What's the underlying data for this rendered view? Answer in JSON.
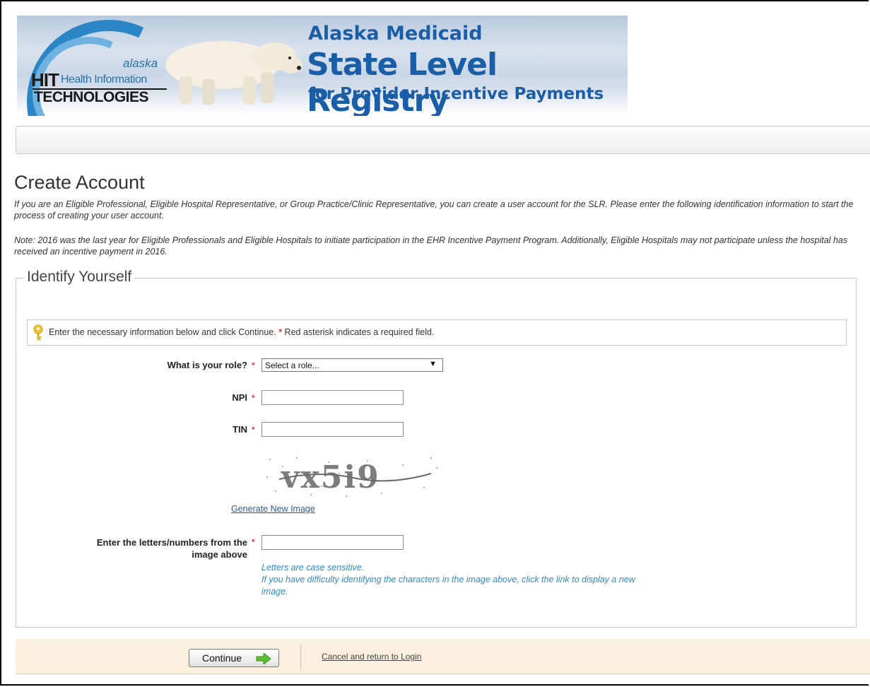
{
  "banner": {
    "logo_alaska": "alaska",
    "logo_hit": "HIT",
    "logo_health_information": "Health Information",
    "logo_technologies": "TECHNOLOGIES",
    "title_line1": "Alaska Medicaid",
    "title_line2": "State Level Registry",
    "title_line3": "for Provider Incentive Payments"
  },
  "page": {
    "title": "Create Account",
    "intro": "If you are an Eligible Professional, Eligible Hospital Representative, or Group Practice/Clinic Representative, you can create a user account for the SLR. Please enter the following identification information to start the process of creating your user account.",
    "note": "Note: 2016 was the last year for Eligible Professionals and Eligible Hospitals to initiate participation in the EHR Incentive Payment Program. Additionally, Eligible Hospitals may not participate unless the hospital has received an incentive payment in 2016."
  },
  "form": {
    "legend": "Identify Yourself",
    "info_text": "Enter the necessary information below and click Continue.",
    "info_required_text": "Red asterisk indicates a required field.",
    "asterisk": "*",
    "role_label": "What is your role?",
    "role_selected": "Select a role...",
    "npi_label": "NPI",
    "npi_value": "",
    "tin_label": "TIN",
    "tin_value": "",
    "captcha_text": "vx5i9",
    "generate_link": "Generate New Image",
    "captcha_label_line1": "Enter the letters/numbers from the",
    "captcha_label_line2": "image above",
    "captcha_value": "",
    "hint_case": "Letters are case sensitive.",
    "hint_difficulty_line1": "If you have difficulty identifying the characters in the image above, click the link to display a new",
    "hint_difficulty_line2": "image."
  },
  "footer": {
    "continue_label": "Continue",
    "cancel_link": "Cancel and return to Login"
  },
  "colors": {
    "required": "#e0403a",
    "hint": "#2e8bd0",
    "banner_text": "#1b5ea8",
    "footer_bg": "#fbf0dd"
  }
}
